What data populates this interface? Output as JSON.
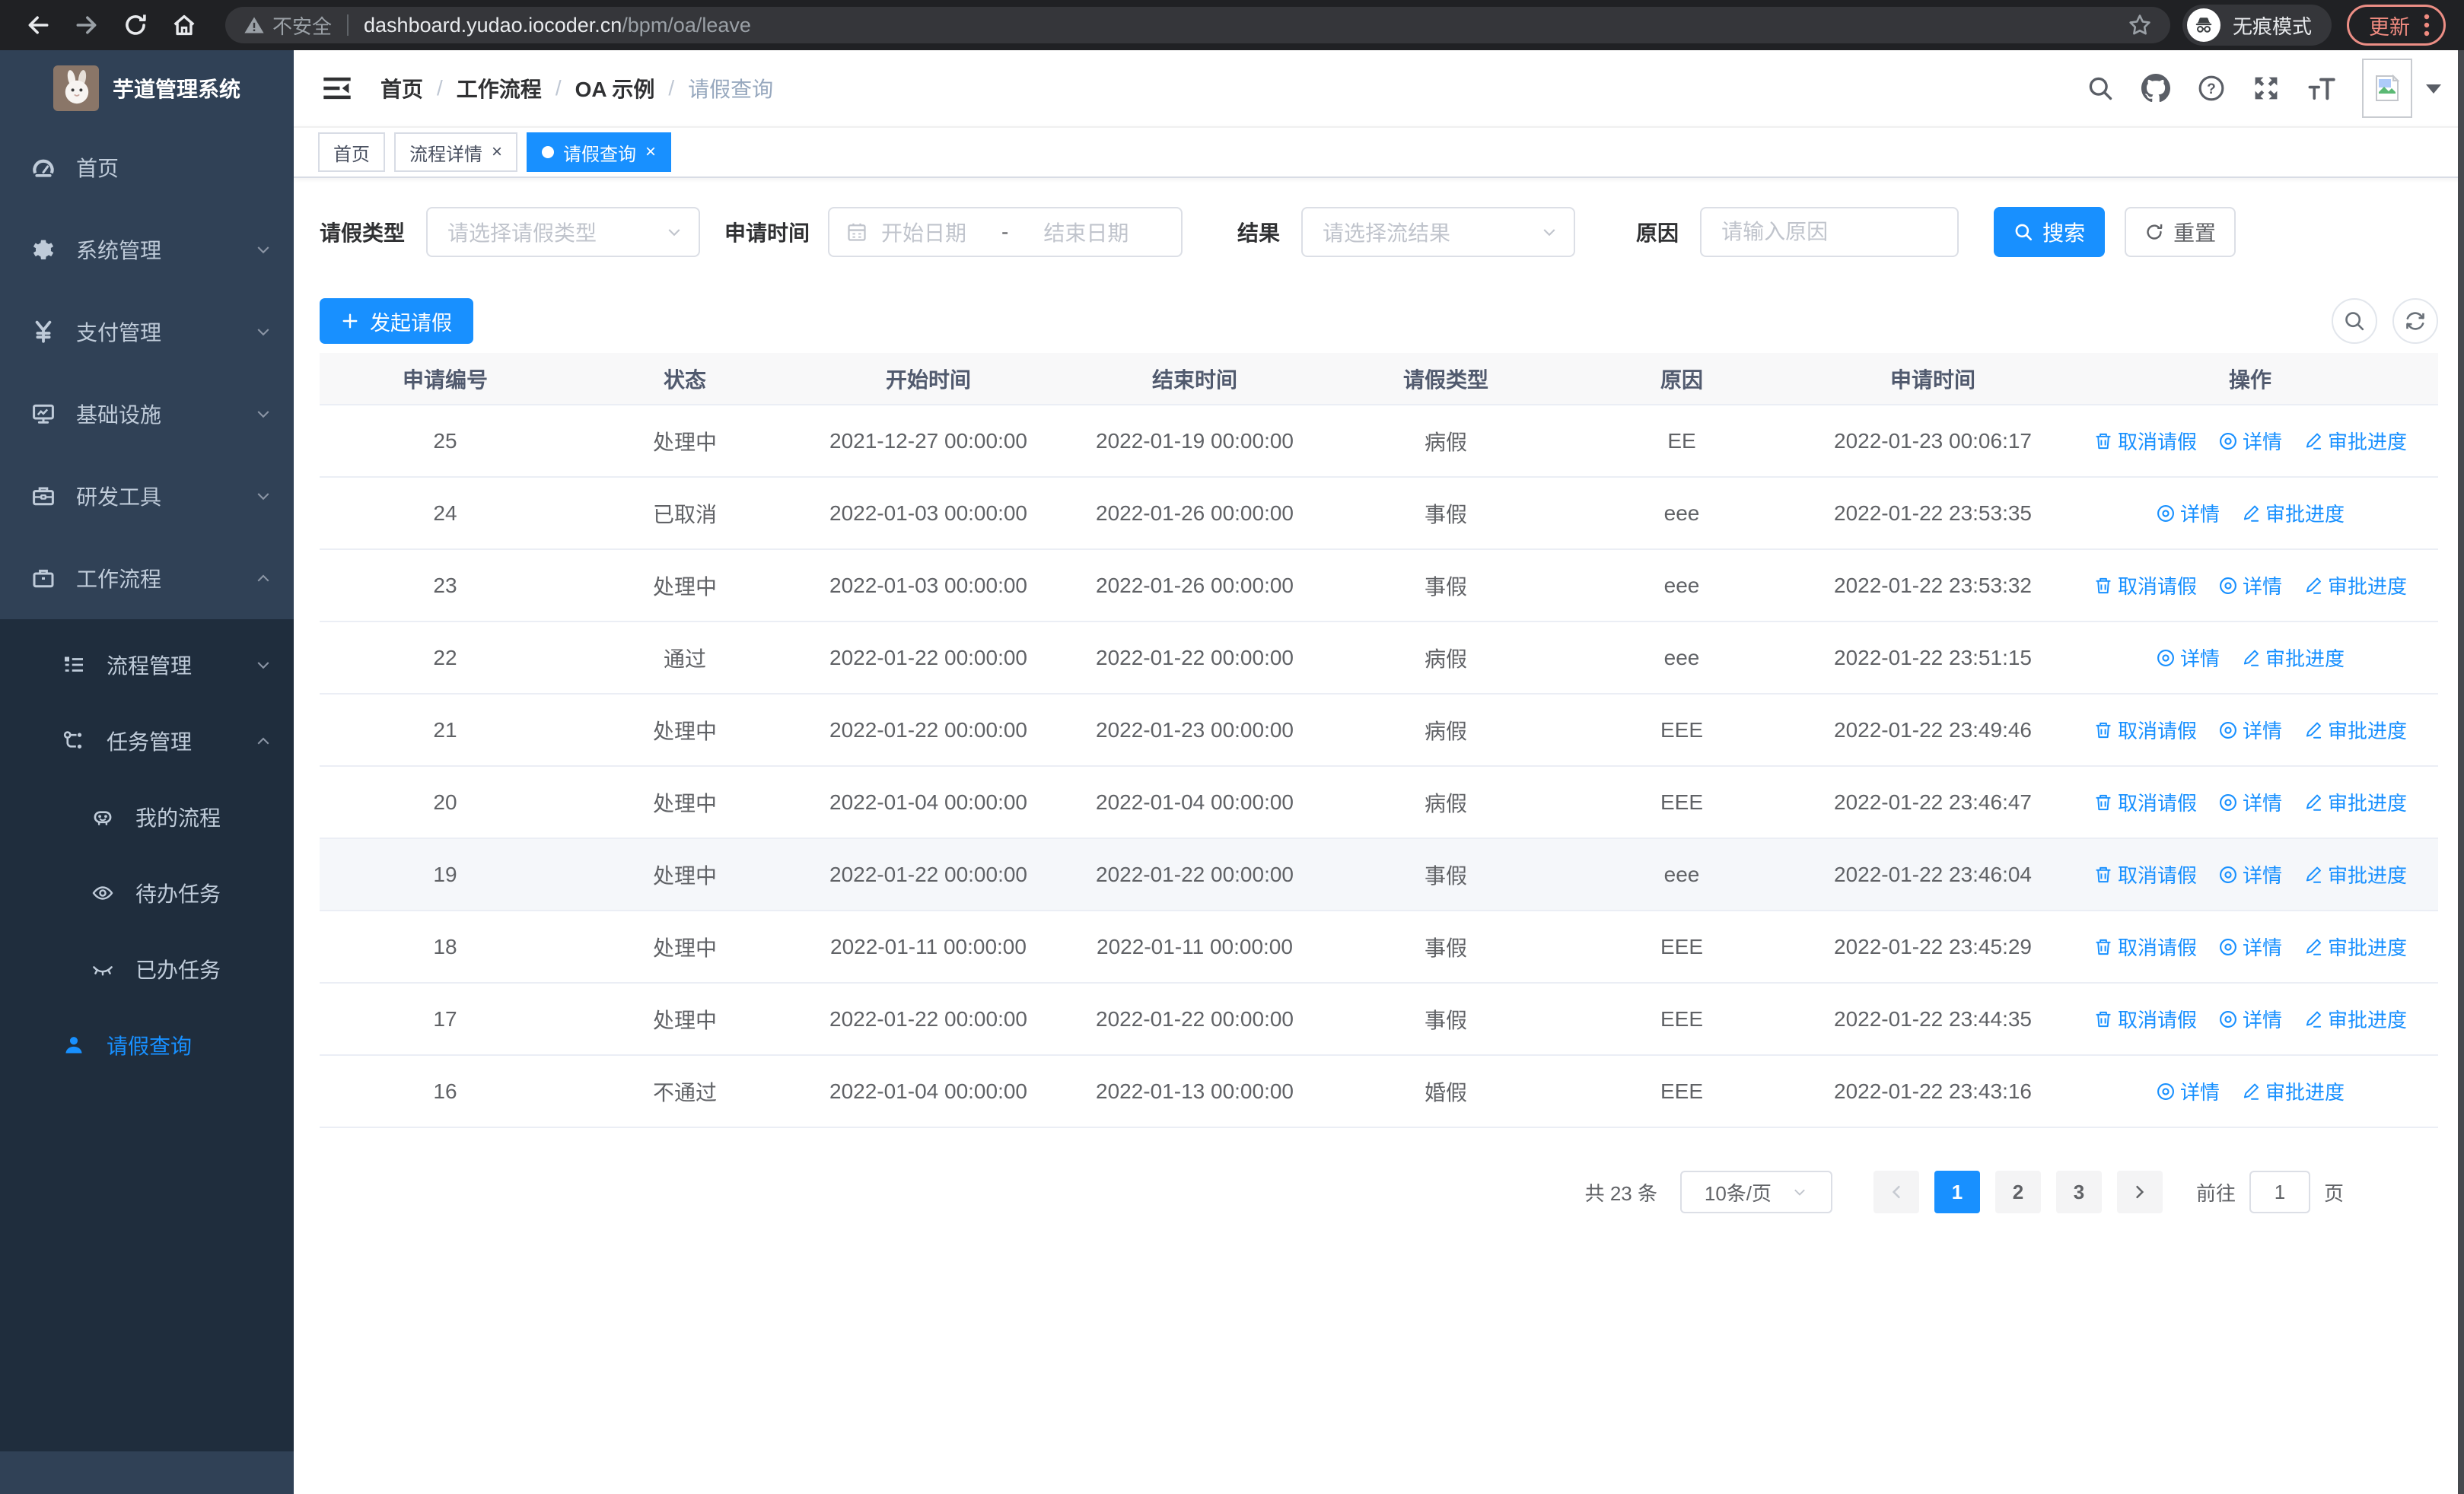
{
  "browser": {
    "security_warning": "不安全",
    "url_host": "dashboard.yudao.iocoder.cn",
    "url_path": "/bpm/oa/leave",
    "incognito_label": "无痕模式",
    "update_label": "更新"
  },
  "sidebar": {
    "app_title": "芋道管理系统",
    "menu": [
      {
        "label": "首页"
      },
      {
        "label": "系统管理"
      },
      {
        "label": "支付管理"
      },
      {
        "label": "基础设施"
      },
      {
        "label": "研发工具"
      },
      {
        "label": "工作流程"
      }
    ],
    "workflow_submenu": [
      {
        "label": "流程管理"
      },
      {
        "label": "任务管理"
      }
    ],
    "task_submenu": [
      {
        "label": "我的流程"
      },
      {
        "label": "待办任务"
      },
      {
        "label": "已办任务"
      }
    ],
    "leave_item": {
      "label": "请假查询"
    }
  },
  "breadcrumb": {
    "separator": "/",
    "items": [
      "首页",
      "工作流程",
      "OA 示例",
      "请假查询"
    ]
  },
  "tabs": [
    {
      "label": "首页"
    },
    {
      "label": "流程详情"
    },
    {
      "label": "请假查询"
    }
  ],
  "filters": {
    "leave_type_label": "请假类型",
    "leave_type_placeholder": "请选择请假类型",
    "apply_time_label": "申请时间",
    "date_start_placeholder": "开始日期",
    "date_separator": "-",
    "date_end_placeholder": "结束日期",
    "result_label": "结果",
    "result_placeholder": "请选择流结果",
    "reason_label": "原因",
    "reason_placeholder": "请输入原因",
    "search_button": "搜索",
    "reset_button": "重置"
  },
  "actions_bar": {
    "create_label": "发起请假"
  },
  "table": {
    "columns": [
      "申请编号",
      "状态",
      "开始时间",
      "结束时间",
      "请假类型",
      "原因",
      "申请时间",
      "操作"
    ],
    "action_labels": {
      "cancel": "取消请假",
      "detail": "详情",
      "progress": "审批进度"
    },
    "rows": [
      {
        "id": "25",
        "status": "处理中",
        "start": "2021-12-27 00:00:00",
        "end": "2022-01-19 00:00:00",
        "type": "病假",
        "reason": "EE",
        "apply_time": "2022-01-23 00:06:17",
        "actions": [
          "cancel",
          "detail",
          "progress"
        ]
      },
      {
        "id": "24",
        "status": "已取消",
        "start": "2022-01-03 00:00:00",
        "end": "2022-01-26 00:00:00",
        "type": "事假",
        "reason": "eee",
        "apply_time": "2022-01-22 23:53:35",
        "actions": [
          "detail",
          "progress"
        ]
      },
      {
        "id": "23",
        "status": "处理中",
        "start": "2022-01-03 00:00:00",
        "end": "2022-01-26 00:00:00",
        "type": "事假",
        "reason": "eee",
        "apply_time": "2022-01-22 23:53:32",
        "actions": [
          "cancel",
          "detail",
          "progress"
        ]
      },
      {
        "id": "22",
        "status": "通过",
        "start": "2022-01-22 00:00:00",
        "end": "2022-01-22 00:00:00",
        "type": "病假",
        "reason": "eee",
        "apply_time": "2022-01-22 23:51:15",
        "actions": [
          "detail",
          "progress"
        ]
      },
      {
        "id": "21",
        "status": "处理中",
        "start": "2022-01-22 00:00:00",
        "end": "2022-01-23 00:00:00",
        "type": "病假",
        "reason": "EEE",
        "apply_time": "2022-01-22 23:49:46",
        "actions": [
          "cancel",
          "detail",
          "progress"
        ]
      },
      {
        "id": "20",
        "status": "处理中",
        "start": "2022-01-04 00:00:00",
        "end": "2022-01-04 00:00:00",
        "type": "病假",
        "reason": "EEE",
        "apply_time": "2022-01-22 23:46:47",
        "actions": [
          "cancel",
          "detail",
          "progress"
        ]
      },
      {
        "id": "19",
        "status": "处理中",
        "start": "2022-01-22 00:00:00",
        "end": "2022-01-22 00:00:00",
        "type": "事假",
        "reason": "eee",
        "apply_time": "2022-01-22 23:46:04",
        "actions": [
          "cancel",
          "detail",
          "progress"
        ],
        "highlighted": true
      },
      {
        "id": "18",
        "status": "处理中",
        "start": "2022-01-11 00:00:00",
        "end": "2022-01-11 00:00:00",
        "type": "事假",
        "reason": "EEE",
        "apply_time": "2022-01-22 23:45:29",
        "actions": [
          "cancel",
          "detail",
          "progress"
        ]
      },
      {
        "id": "17",
        "status": "处理中",
        "start": "2022-01-22 00:00:00",
        "end": "2022-01-22 00:00:00",
        "type": "事假",
        "reason": "EEE",
        "apply_time": "2022-01-22 23:44:35",
        "actions": [
          "cancel",
          "detail",
          "progress"
        ]
      },
      {
        "id": "16",
        "status": "不通过",
        "start": "2022-01-04 00:00:00",
        "end": "2022-01-13 00:00:00",
        "type": "婚假",
        "reason": "EEE",
        "apply_time": "2022-01-22 23:43:16",
        "actions": [
          "detail",
          "progress"
        ]
      }
    ]
  },
  "pagination": {
    "total": "共 23 条",
    "page_size": "10条/页",
    "pages": [
      "1",
      "2",
      "3"
    ],
    "goto_label": "前往",
    "goto_value": "1",
    "goto_unit": "页"
  },
  "colors": {
    "primary": "#1890ff",
    "sidebar_bg": "#304156",
    "submenu_bg": "#1f2d3d",
    "chrome_bg": "#202124",
    "update_accent": "#f08b80"
  }
}
